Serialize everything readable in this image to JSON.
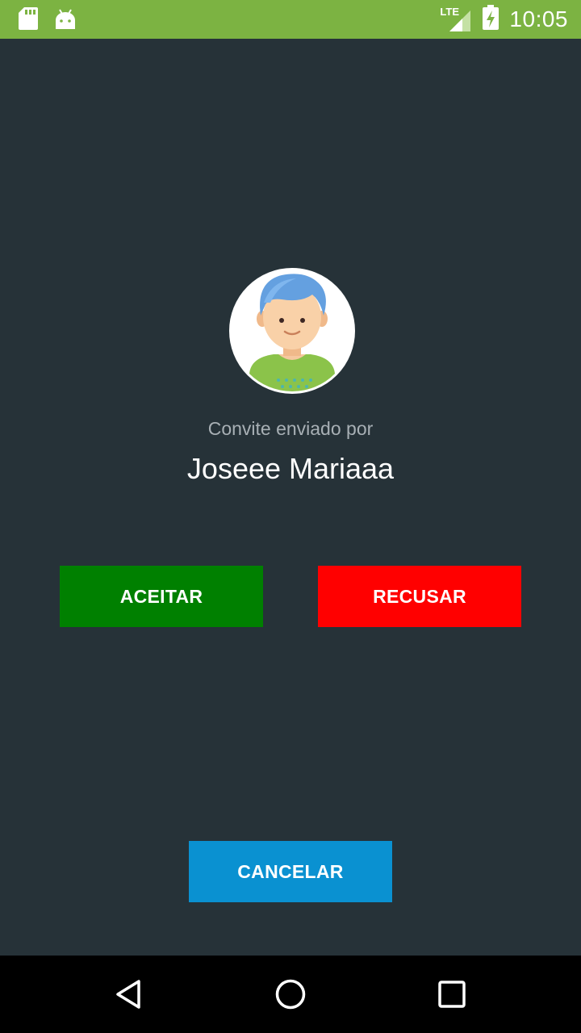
{
  "status_bar": {
    "network": "LTE",
    "time": "10:05",
    "icons": [
      "sd-card-icon",
      "android-icon",
      "signal-icon",
      "battery-charging-icon"
    ]
  },
  "invite": {
    "subtitle": "Convite enviado por",
    "sender_name": "Joseee Mariaaa",
    "avatar": "avatar-boy-icon"
  },
  "actions": {
    "accept_label": "ACEITAR",
    "decline_label": "RECUSAR",
    "cancel_label": "CANCELAR"
  },
  "nav_bar": {
    "icons": [
      "back-triangle-icon",
      "home-circle-icon",
      "recents-square-icon"
    ]
  },
  "colors": {
    "status_bar": "#7cb342",
    "background": "#263238",
    "accept": "#008000",
    "decline": "#ff0000",
    "cancel": "#0a91d1"
  }
}
